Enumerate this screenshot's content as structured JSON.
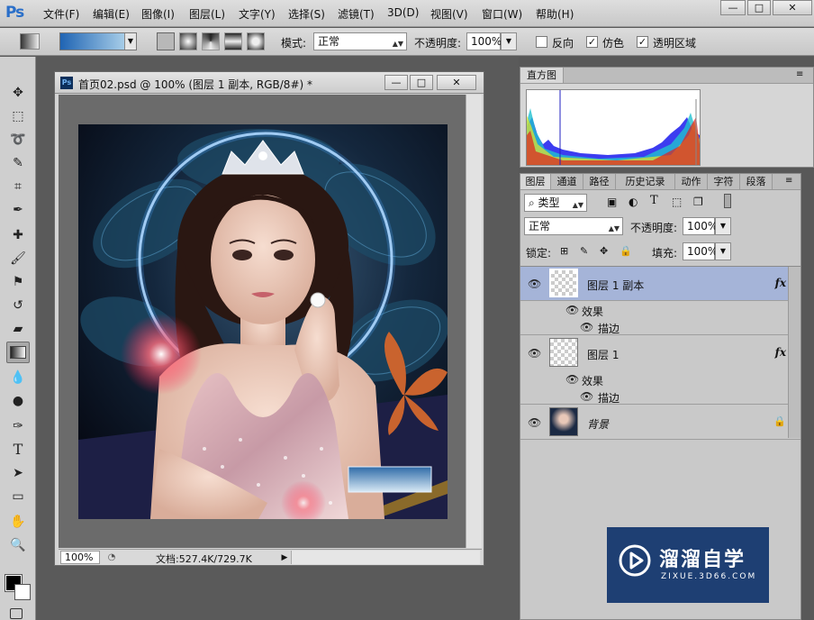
{
  "app": {
    "logo": "Ps"
  },
  "menu": [
    "文件(F)",
    "编辑(E)",
    "图像(I)",
    "图层(L)",
    "文字(Y)",
    "选择(S)",
    "滤镜(T)",
    "3D(D)",
    "视图(V)",
    "窗口(W)",
    "帮助(H)"
  ],
  "window_controls": {
    "minimize": "—",
    "maximize": "□",
    "close": "✕"
  },
  "options": {
    "mode_label": "模式:",
    "mode_value": "正常",
    "opacity_label": "不透明度:",
    "opacity_value": "100%",
    "reverse_label": "反向",
    "dither_label": "仿色",
    "transparency_label": "透明区域",
    "reverse_checked": false,
    "dither_checked": true,
    "transparency_checked": true
  },
  "document": {
    "title": "首页02.psd @ 100% (图层 1 副本, RGB/8#) *",
    "zoom": "100%",
    "doc_info": "文档:527.4K/729.7K"
  },
  "histogram": {
    "tab": "直方图"
  },
  "layers_panel": {
    "tabs": [
      "图层",
      "通道",
      "路径",
      "历史记录",
      "动作",
      "字符",
      "段落"
    ],
    "filter_label": "类型",
    "blend_mode": "正常",
    "opacity_label": "不透明度:",
    "opacity_value": "100%",
    "lock_label": "锁定:",
    "fill_label": "填充:",
    "fill_value": "100%",
    "layers": [
      {
        "name": "图层 1 副本",
        "effects_label": "效果",
        "effect": "描边",
        "selected": true
      },
      {
        "name": "图层 1",
        "effects_label": "效果",
        "effect": "描边",
        "selected": false
      },
      {
        "name": "背景",
        "selected": false
      }
    ]
  },
  "watermark": {
    "title": "溜溜自学",
    "url": "ZIXUE.3D66.COM"
  },
  "colors": {
    "accent": "#2a6fc9",
    "selected_layer": "#a5b4d8",
    "watermark_bg": "#1e3f73"
  }
}
